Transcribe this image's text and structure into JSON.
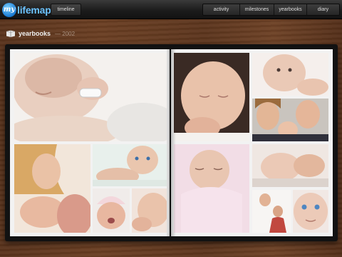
{
  "app": {
    "logo_badge": "my",
    "logo_text": "lifemap"
  },
  "topbar": {
    "timeline_label": "timeline",
    "nav": [
      "activity",
      "milestones",
      "yearbooks",
      "diary"
    ]
  },
  "section": {
    "title": "yearbooks",
    "year": "2002"
  },
  "photos": [
    "sleeping-newborn-hospital-band",
    "sleeping-newborn-closeup",
    "baby-face",
    "parents-with-baby",
    "mother-with-baby",
    "baby-on-tummy",
    "baby-wrapped-in-blanket",
    "baby-being-held",
    "baby-in-hat-crying",
    "baby-resting",
    "mother-lifting-baby",
    "baby-blue-eyes"
  ]
}
